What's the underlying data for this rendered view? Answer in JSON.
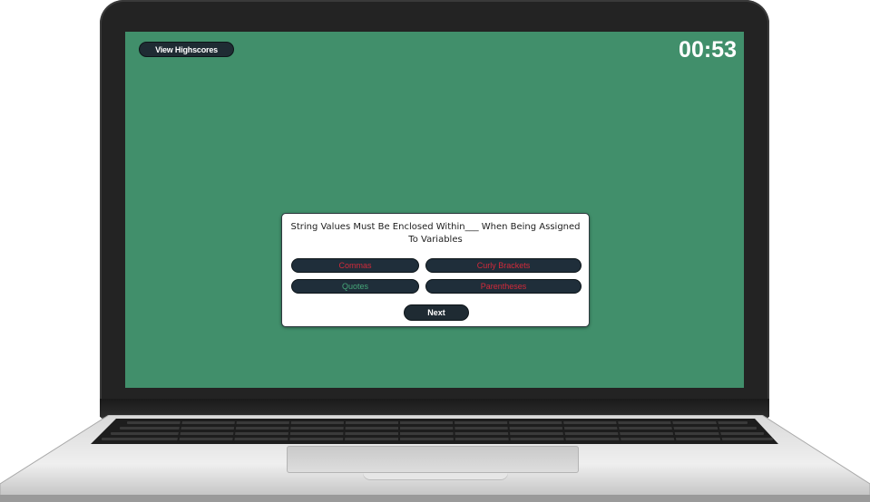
{
  "header": {
    "highscores_label": "View Highscores",
    "timer": "00:53"
  },
  "quiz": {
    "question": "String Values Must Be Enclosed Within___ When Being Assigned To Variables",
    "answers": [
      {
        "label": "Commas",
        "status": "wrong"
      },
      {
        "label": "Curly Brackets",
        "status": "wrong"
      },
      {
        "label": "Quotes",
        "status": "correct"
      },
      {
        "label": "Parentheses",
        "status": "wrong"
      }
    ],
    "next_label": "Next"
  },
  "colors": {
    "screen_background": "#418f6b",
    "button_background": "#1f2b33",
    "wrong_answer_text": "#d42a3a",
    "correct_answer_text": "#46a77a"
  }
}
